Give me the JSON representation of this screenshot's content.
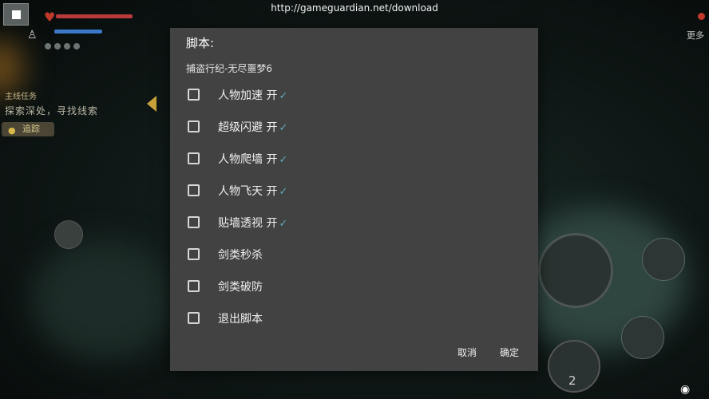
{
  "url_bar": "http://gameguardian.net/download",
  "game_hud": {
    "quest_title": "主线任务",
    "quest_text": "探索深处，寻找线索",
    "track_button": "追踪",
    "more_label": "更多",
    "item_count": "2"
  },
  "dialog": {
    "title": "脚本:",
    "subtitle": "捕盗行纪-无尽噩梦6",
    "options": [
      {
        "label": "人物加速 开",
        "checkmark": "✓"
      },
      {
        "label": "超级闪避 开",
        "checkmark": "✓"
      },
      {
        "label": "人物爬墙 开",
        "checkmark": "✓"
      },
      {
        "label": "人物飞天 开",
        "checkmark": "✓"
      },
      {
        "label": "贴墙透视 开",
        "checkmark": "✓"
      },
      {
        "label": "剑类秒杀",
        "checkmark": ""
      },
      {
        "label": "剑类破防",
        "checkmark": ""
      },
      {
        "label": "退出脚本",
        "checkmark": ""
      }
    ],
    "cancel_label": "取消",
    "confirm_label": "确定"
  },
  "colors": {
    "dialog_bg": "#424242",
    "checkmark": "#5aa9b5",
    "health_bar": "#b83a3a",
    "mana_bar": "#3a78c8"
  },
  "icons": [
    "heart-icon",
    "bell-icon",
    "location-pin-icon",
    "left-arrow-icon",
    "sword-skill-icon",
    "eye-icon"
  ]
}
